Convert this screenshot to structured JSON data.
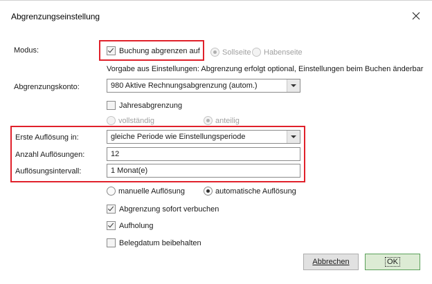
{
  "window": {
    "title": "Abgrenzungseinstellung",
    "close_glyph": "✕"
  },
  "modus": {
    "label": "Modus:",
    "checkbox_label": "Buchung abgrenzen auf",
    "checked": true,
    "radio_soll": "Sollseite",
    "radio_haben": "Habenseite",
    "note": "Vorgabe aus Einstellungen: Abgrenzung erfolgt optional, Einstellungen beim Buchen änderbar"
  },
  "konto": {
    "label": "Abgrenzungskonto:",
    "value": "980 Aktive Rechnungsabgrenzung (autom.)"
  },
  "jahres": {
    "label": "Jahresabgrenzung",
    "checked": false
  },
  "verteilung": {
    "vollstaendig": "vollständig",
    "anteilig": "anteilig"
  },
  "erste": {
    "label": "Erste Auflösung in:",
    "value": "gleiche Periode wie Einstellungsperiode"
  },
  "anzahl": {
    "label": "Anzahl Auflösungen:",
    "value": "12"
  },
  "intervall": {
    "label": "Auflösungsintervall:",
    "value": "1 Monat(e)"
  },
  "aufloesung": {
    "manuell": "manuelle Auflösung",
    "automatisch": "automatische Auflösung",
    "selected": "automatisch"
  },
  "sofort": {
    "label": "Abgrenzung sofort verbuchen",
    "checked": true
  },
  "aufholung": {
    "label": "Aufholung",
    "checked": true
  },
  "belegdatum": {
    "label": "Belegdatum beibehalten",
    "checked": false
  },
  "buttons": {
    "cancel": "Abbrechen",
    "ok": "OK"
  },
  "colors": {
    "highlight": "#e0202a",
    "ok_border": "#5aa05a"
  }
}
